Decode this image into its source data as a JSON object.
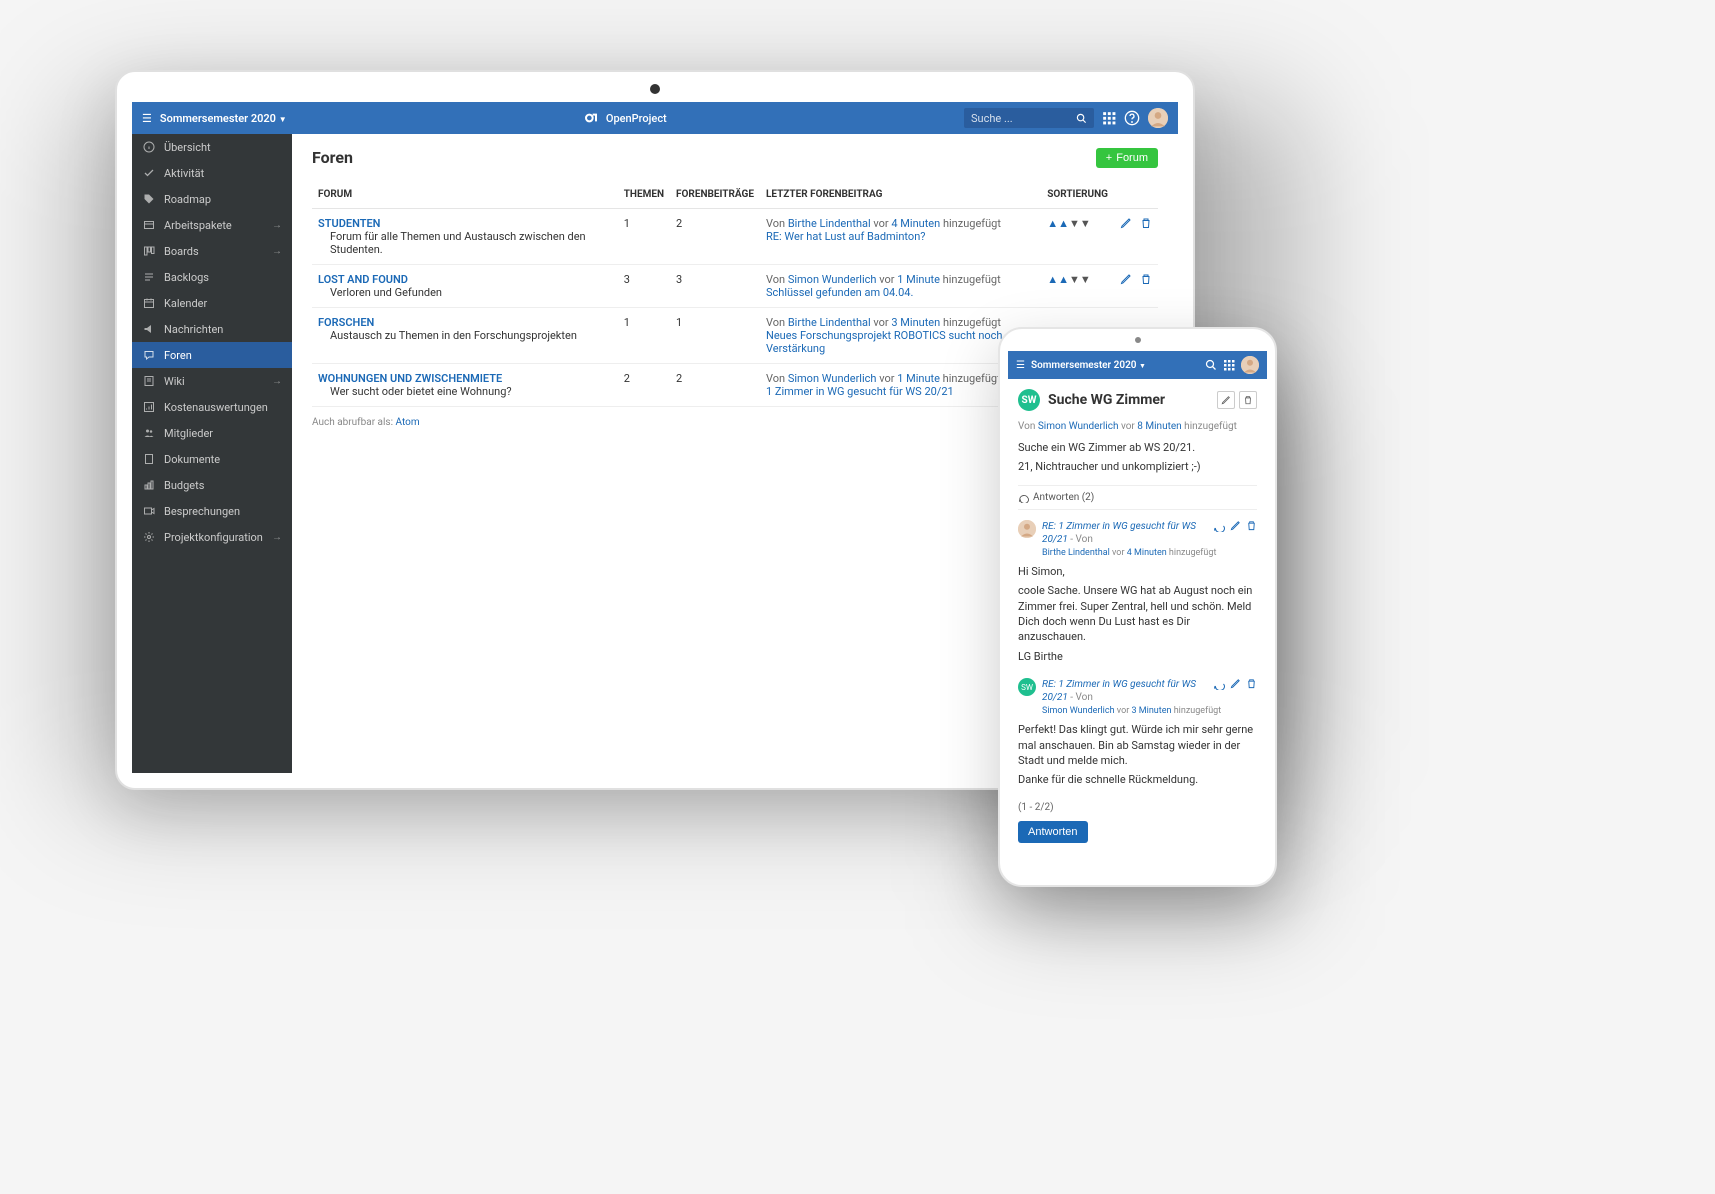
{
  "tablet": {
    "topbar": {
      "project": "Sommersemester 2020",
      "brand": "OpenProject",
      "searchPlaceholder": "Suche ..."
    },
    "sidebar": [
      {
        "icon": "info",
        "label": "Übersicht",
        "arrow": false
      },
      {
        "icon": "check",
        "label": "Aktivität",
        "arrow": false
      },
      {
        "icon": "tag",
        "label": "Roadmap",
        "arrow": false
      },
      {
        "icon": "wp",
        "label": "Arbeitspakete",
        "arrow": true
      },
      {
        "icon": "boards",
        "label": "Boards",
        "arrow": true
      },
      {
        "icon": "backlogs",
        "label": "Backlogs",
        "arrow": false
      },
      {
        "icon": "calendar",
        "label": "Kalender",
        "arrow": false
      },
      {
        "icon": "news",
        "label": "Nachrichten",
        "arrow": false
      },
      {
        "icon": "forum",
        "label": "Foren",
        "arrow": false,
        "active": true
      },
      {
        "icon": "wiki",
        "label": "Wiki",
        "arrow": true
      },
      {
        "icon": "cost",
        "label": "Kostenauswertungen",
        "arrow": false
      },
      {
        "icon": "members",
        "label": "Mitglieder",
        "arrow": false
      },
      {
        "icon": "doc",
        "label": "Dokumente",
        "arrow": false
      },
      {
        "icon": "budget",
        "label": "Budgets",
        "arrow": false
      },
      {
        "icon": "meeting",
        "label": "Besprechungen",
        "arrow": false
      },
      {
        "icon": "settings",
        "label": "Projektkonfiguration",
        "arrow": true
      }
    ],
    "content": {
      "title": "Foren",
      "addButton": "Forum",
      "columns": {
        "forum": "FORUM",
        "topics": "THEMEN",
        "posts": "FORENBEITRÄGE",
        "last": "LETZTER FORENBEITRAG",
        "sort": "SORTIERUNG"
      },
      "rows": [
        {
          "title": "STUDENTEN",
          "desc": "Forum für alle Themen und Austausch zwischen den Studenten.",
          "topics": "1",
          "posts": "2",
          "lastBy": "Birthe Lindenthal",
          "lastTime": "4 Minuten",
          "lastSubject": "RE: Wer hat Lust auf Badminton?"
        },
        {
          "title": "LOST AND FOUND",
          "desc": "Verloren und Gefunden",
          "topics": "3",
          "posts": "3",
          "lastBy": "Simon Wunderlich",
          "lastTime": "1 Minute",
          "lastSubject": "Schlüssel gefunden am 04.04."
        },
        {
          "title": "FORSCHEN",
          "desc": "Austausch zu Themen in den Forschungsprojekten",
          "topics": "1",
          "posts": "1",
          "lastBy": "Birthe Lindenthal",
          "lastTime": "3 Minuten",
          "lastSubject": "Neues Forschungsprojekt ROBOTICS sucht noch Verstärkung"
        },
        {
          "title": "WOHNUNGEN UND ZWISCHENMIETE",
          "desc": "Wer sucht oder bietet eine Wohnung?",
          "topics": "2",
          "posts": "2",
          "lastBy": "Simon Wunderlich",
          "lastTime": "1 Minute",
          "lastSubject": "1 Zimmer in WG gesucht für WS 20/21"
        }
      ],
      "lastPrefix": "Von ",
      "lastMid": " vor ",
      "lastSuffix": " hinzugefügt",
      "atom": "Auch abrufbar als: ",
      "atomLink": "Atom"
    }
  },
  "phone": {
    "topbar": {
      "project": "Sommersemester 2020"
    },
    "thread": {
      "avatar": "SW",
      "title": "Suche WG Zimmer",
      "metaPrefix": "Von ",
      "author": "Simon Wunderlich",
      "metaMid": " vor ",
      "time": "8 Minuten",
      "metaSuffix": " hinzugefügt",
      "body1": "Suche ein WG Zimmer ab WS 20/21.",
      "body2": "21, Nichtraucher und unkompliziert ;-)",
      "repliesLabel": "Antworten (2)",
      "replies": [
        {
          "avatarType": "img",
          "subject": "RE: 1 Zimmer in WG gesucht für WS 20/21",
          "byLabel": " - Von ",
          "author": "Birthe Lindenthal",
          "time": "4 Minuten",
          "paras": [
            "Hi Simon,",
            "coole Sache. Unsere WG hat ab August noch ein Zimmer frei. Super Zentral, hell und schön. Meld Dich doch wenn Du Lust hast es Dir anzuschauen.",
            "LG Birthe"
          ]
        },
        {
          "avatarType": "sw",
          "avatar": "SW",
          "subject": "RE: 1 Zimmer in WG gesucht für WS 20/21",
          "byLabel": " - Von ",
          "author": "Simon Wunderlich",
          "time": "3 Minuten",
          "paras": [
            "Perfekt! Das klingt gut. Würde ich mir sehr gerne mal anschauen. Bin ab Samstag wieder in der Stadt und melde mich.",
            "Danke für die schnelle Rückmeldung."
          ]
        }
      ],
      "pager": "(1 - 2/2)",
      "replyButton": "Antworten"
    }
  }
}
